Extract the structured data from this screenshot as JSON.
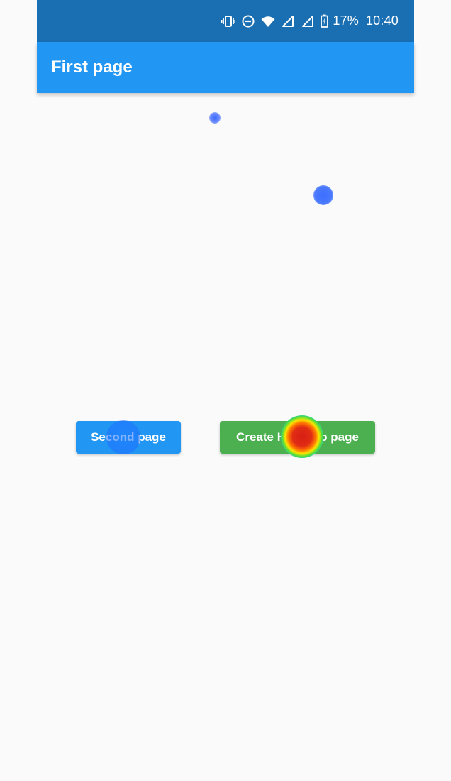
{
  "status_bar": {
    "icons": [
      "vibrate-icon",
      "do-not-disturb-icon",
      "wifi-icon",
      "cell-signal-icon",
      "cell-signal-icon",
      "battery-charging-icon"
    ],
    "battery_percent": "17%",
    "time": "10:40",
    "color": "#1a6fb3"
  },
  "app_bar": {
    "title": "First page",
    "color": "#2196f3"
  },
  "buttons": {
    "second_page": {
      "label": "Second page",
      "color": "#2196f3"
    },
    "create_heatmap": {
      "label": "Create HeatMap page",
      "color": "#4caf50"
    }
  },
  "heatmap": {
    "points": [
      {
        "name": "heat-spot-small",
        "intensity": "low",
        "color": "#3264ff"
      },
      {
        "name": "heat-spot-medium",
        "intensity": "low",
        "color": "#3c6eff"
      },
      {
        "name": "heat-spot-second-button",
        "intensity": "low",
        "color": "#1e78ff"
      },
      {
        "name": "heat-spot-heatmap-button",
        "intensity": "high",
        "color": "#d71e14"
      }
    ]
  },
  "background": "#fafafa"
}
